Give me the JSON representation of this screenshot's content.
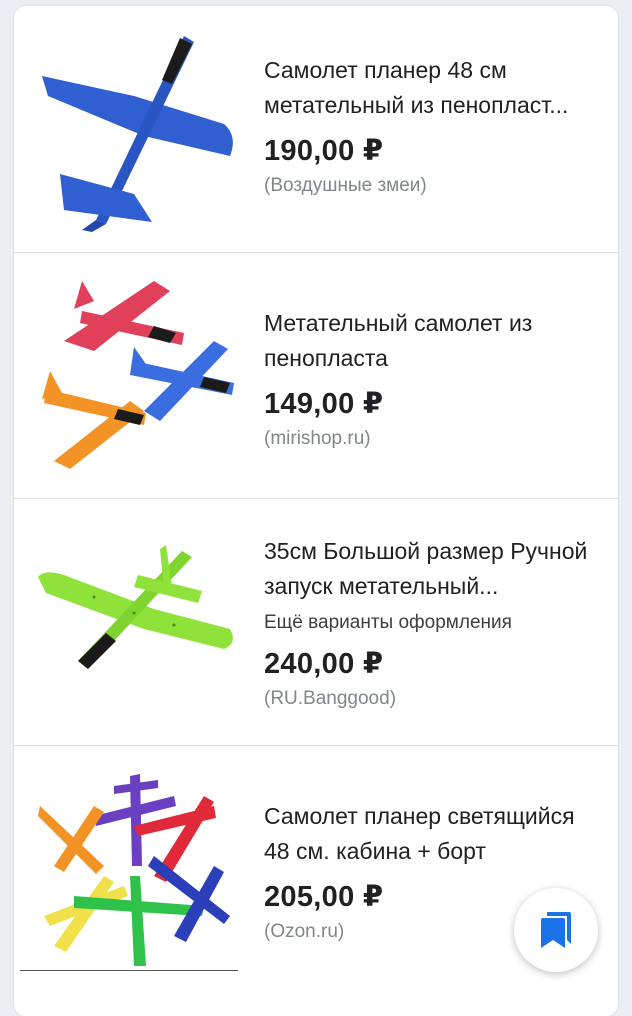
{
  "items": [
    {
      "title": "Самолет планер 48 см метательный из пенопласт...",
      "price": "190,00 ₽",
      "source": "(Воздушные змеи)",
      "image": "blue-glider-plane"
    },
    {
      "title": "Метательный самолет из пенопласта",
      "price": "149,00 ₽",
      "source": "(mirishop.ru)",
      "image": "three-foam-planes"
    },
    {
      "title": "35см Большой размер Ручной запуск метательный...",
      "variants": "Ещё варианты оформления",
      "price": "240,00 ₽",
      "source": "(RU.Banggood)",
      "image": "green-glider-plane"
    },
    {
      "title": "Самолет планер светящийся 48 см. кабина + борт",
      "price": "205,00 ₽",
      "source": "(Ozon.ru)",
      "image": "six-colored-planes"
    }
  ],
  "fab": {
    "icon": "bookmarks-icon",
    "color": "#1a73e8"
  },
  "colors": {
    "blue_plane": "#2f5fd0",
    "red_plane": "#e0405a",
    "orange_plane": "#f39325",
    "green_plane": "#8fe23a",
    "purple_plane": "#6a3fc2"
  }
}
